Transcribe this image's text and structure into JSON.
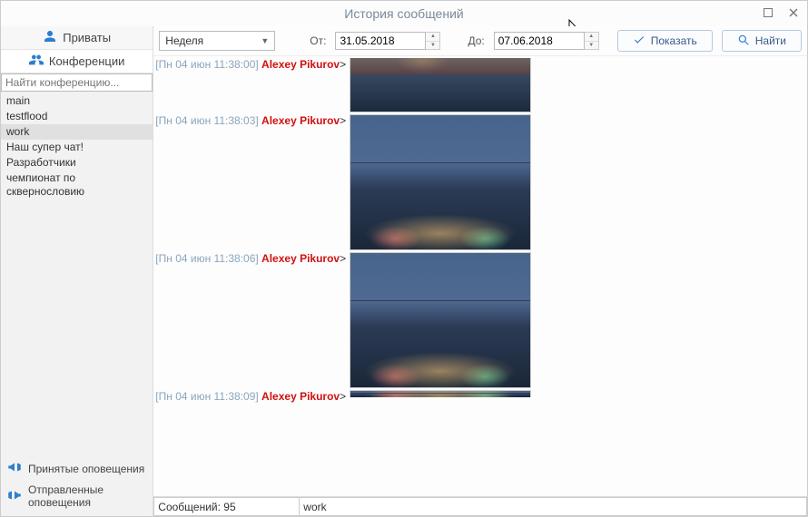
{
  "window": {
    "title": "История сообщений"
  },
  "sidebar": {
    "tabs": {
      "privates": "Приваты",
      "conferences": "Конференции"
    },
    "search_placeholder": "Найти конференцию...",
    "conferences": [
      {
        "name": "main",
        "selected": false
      },
      {
        "name": "testflood",
        "selected": false
      },
      {
        "name": "work",
        "selected": true
      },
      {
        "name": "Наш супер чат!",
        "selected": false
      },
      {
        "name": "Разработчики",
        "selected": false
      },
      {
        "name": "чемпионат по сквернословию",
        "selected": false
      }
    ],
    "bottom": {
      "received": "Принятые оповещения",
      "sent": "Отправленные оповещения"
    }
  },
  "toolbar": {
    "period_selected": "Неделя",
    "from_label": "От:",
    "to_label": "До:",
    "from_value": "31.05.2018",
    "to_value": "07.06.2018",
    "show_label": "Показать",
    "find_label": "Найти"
  },
  "messages": [
    {
      "timestamp": "[Пн 04 июн 11:38:00]",
      "sender": "Alexey Pikurov",
      "variant": "variant-1",
      "cropped": true
    },
    {
      "timestamp": "[Пн 04 июн 11:38:03]",
      "sender": "Alexey Pikurov",
      "variant": "",
      "cropped": false
    },
    {
      "timestamp": "[Пн 04 июн 11:38:06]",
      "sender": "Alexey Pikurov",
      "variant": "",
      "cropped": false
    },
    {
      "timestamp": "[Пн 04 июн 11:38:09]",
      "sender": "Alexey Pikurov",
      "variant": "",
      "cropped": true,
      "bottom": true
    }
  ],
  "status": {
    "count_label": "Сообщений: 95",
    "room": "work"
  }
}
